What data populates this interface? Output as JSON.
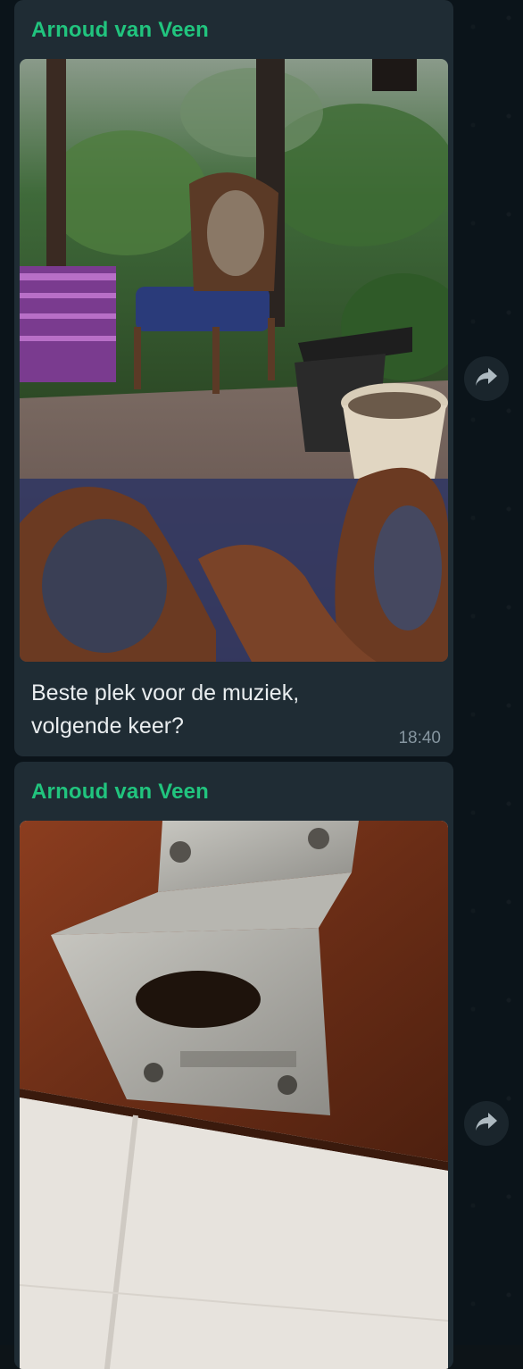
{
  "messages": [
    {
      "sender": "Arnoud van Veen",
      "caption": "Beste plek voor de muziek, volgende keer?",
      "time": "18:40",
      "media_type": "photo"
    },
    {
      "sender": "Arnoud van Veen",
      "media_type": "photo"
    }
  ],
  "icons": {
    "forward": "forward-icon"
  },
  "colors": {
    "chat_background": "#0b141a",
    "bubble_background": "#1f2c34",
    "sender_name": "#21c47e",
    "message_text": "#e9edef",
    "timestamp": "#8696a0"
  }
}
